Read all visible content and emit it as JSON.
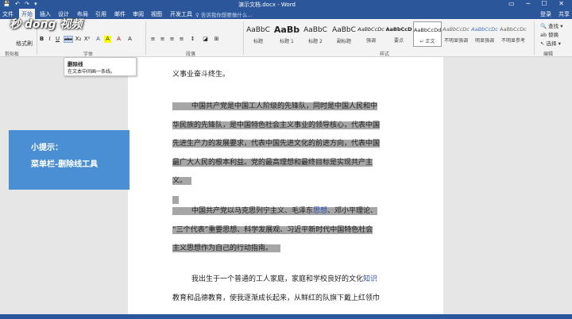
{
  "window": {
    "title": "演示文档.docx - Word",
    "quick_access": "💾 ↶ ↷ ▾",
    "controls": "▭ ─ ☐ ✕"
  },
  "tabs": [
    {
      "label": "文件"
    },
    {
      "label": "开始"
    },
    {
      "label": "插入"
    },
    {
      "label": "设计"
    },
    {
      "label": "布局"
    },
    {
      "label": "引用"
    },
    {
      "label": "邮件"
    },
    {
      "label": "审阅"
    },
    {
      "label": "视图"
    },
    {
      "label": "开发工具"
    }
  ],
  "tell_me": "♀ 告诉我你想要做什么...",
  "account": {
    "login": "登录",
    "share": "共享"
  },
  "ribbon": {
    "clipboard": {
      "label": "剪贴板",
      "format_painter": "格式刷"
    },
    "font": {
      "label": "字体",
      "buttons": [
        "B",
        "I",
        "U",
        "abc",
        "X₂",
        "X²",
        "A",
        "A",
        "A",
        "A"
      ]
    },
    "paragraph": {
      "label": "段落"
    },
    "styles": {
      "label": "样式",
      "items": [
        {
          "sample": "AaBbC",
          "name": "标题"
        },
        {
          "sample": "AaBb",
          "name": "标题 1"
        },
        {
          "sample": "AaBbC",
          "name": "标题 2"
        },
        {
          "sample": "AaBbC",
          "name": "副标题"
        },
        {
          "sample": "AaBbCcDc",
          "name": "强调"
        },
        {
          "sample": "AaBbCcD",
          "name": "要点"
        },
        {
          "sample": "AaBbCcDd",
          "name": "↵ 正文"
        },
        {
          "sample": "AaBbCcDc",
          "name": "不明显强调"
        },
        {
          "sample": "AaBbCcDc",
          "name": "明显强调"
        },
        {
          "sample": "AaBbCcDc",
          "name": "不明显参考"
        }
      ]
    },
    "editing": {
      "label": "编辑",
      "find": "🔍 查找 ▾",
      "replace": "ab 替换",
      "select": "↖ 选择 ▾"
    }
  },
  "tooltip": {
    "title": "删除线",
    "description": "在文本中间画一条线。"
  },
  "watermark_logo": "秒 dong 视频",
  "document": {
    "p0": [
      "…………………………………………………",
      "义事业奋斗终生。"
    ],
    "p1": [
      "中国共产党是中国工人阶级的先锋队，同时是中国人民和中",
      "华民族的先锋队，是中国特色社会主义事业的领导核心，代表中国",
      "先进生产力的发展要求，代表中国先进文化的前进方向，代表中国",
      "最广大人民的根本利益。党的最高理想和最终目标是实现共产主",
      "义。"
    ],
    "p2": [
      {
        "pre": "中国共产党以马克思列宁主义、毛泽东",
        "link": "思想",
        "post": "、邓小平理论、"
      },
      {
        "pre": "“三个代表”重要思想、科学发展观、习近平新时代中国特色社会",
        "link": "",
        "post": ""
      },
      {
        "pre": "主义思想作为自己的行动指南。",
        "link": "",
        "post": ""
      }
    ],
    "p3": [
      {
        "pre": "我出生于一个普通的工人家庭，家庭和学校良好的文化",
        "link": "知识",
        "post": ""
      },
      {
        "pre": "教育和品德教育，使我逐渐成长起来，从鲜红的队旗下戴上红领巾",
        "link": "",
        "post": ""
      }
    ]
  },
  "tip_box": {
    "line1": "小提示：",
    "line2": "菜单栏-删除线工具"
  },
  "colors": {
    "accent": "#2b579a",
    "tip_bg": "#4a8fd4",
    "highlight": "#a6a6a6"
  }
}
